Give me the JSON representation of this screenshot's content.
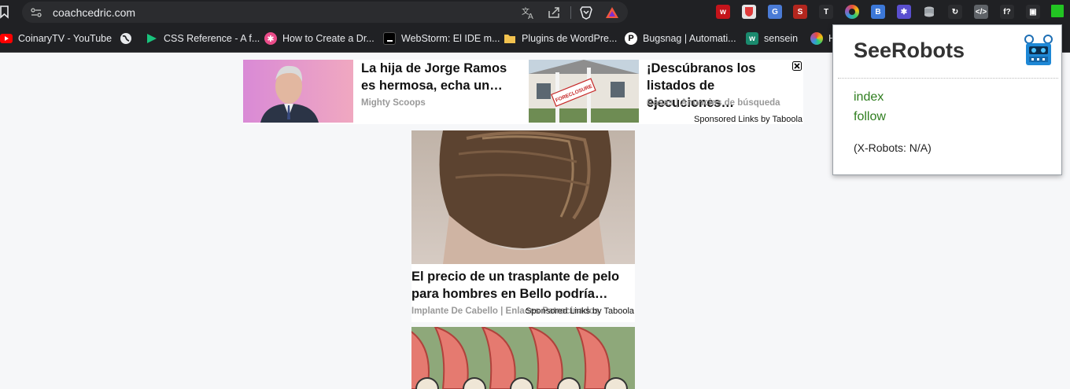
{
  "browser": {
    "url": "coachcedric.com",
    "extensions": [
      {
        "name": "wordpress-extension-icon",
        "color": "#c4141b",
        "glyph": "w"
      },
      {
        "name": "brave-shield-extension-icon",
        "color": "#e5e5e5",
        "glyph": ""
      },
      {
        "name": "translate-extension-icon",
        "color": "#4a7bd6",
        "glyph": "G"
      },
      {
        "name": "seo-extension-icon",
        "color": "#b3261e",
        "glyph": "S"
      },
      {
        "name": "typography-extension-icon",
        "color": "#2b2c2f",
        "glyph": "T"
      },
      {
        "name": "color-picker-extension-icon",
        "color": "#7b3fe4",
        "glyph": ""
      },
      {
        "name": "box-extension-icon",
        "color": "#3c78d8",
        "glyph": "B"
      },
      {
        "name": "gear-extension-icon",
        "color": "#5a4fcf",
        "glyph": "✱"
      },
      {
        "name": "database-extension-icon",
        "color": "#8a8d91",
        "glyph": ""
      },
      {
        "name": "refresh-extension-icon",
        "color": "#2b2c2f",
        "glyph": "↻"
      },
      {
        "name": "code-extension-icon",
        "color": "#5f6368",
        "glyph": "</>"
      },
      {
        "name": "font-extension-icon",
        "color": "#2b2c2f",
        "glyph": "f?"
      },
      {
        "name": "window-extension-icon",
        "color": "#2b2c2f",
        "glyph": "▣"
      },
      {
        "name": "seerobots-extension-icon",
        "color": "#22c422",
        "glyph": ""
      }
    ]
  },
  "bookmarks": [
    {
      "label": "CoinaryTV - YouTube",
      "icon": "youtube-icon",
      "color": "#ff0000"
    },
    {
      "label": "",
      "icon": "globe-icon",
      "color": "#e8eaed"
    },
    {
      "label": "CSS Reference - A f...",
      "icon": "css-reference-icon",
      "color": "#19c37d"
    },
    {
      "label": "How to Create a Dr...",
      "icon": "dribbble-icon",
      "color": "#ea4c89"
    },
    {
      "label": "WebStorm: El IDE m...",
      "icon": "webstorm-icon",
      "color": "#000000"
    },
    {
      "label": "Plugins de WordPre...",
      "icon": "folder-icon",
      "color": "#f2c24f"
    },
    {
      "label": "Bugsnag | Automati...",
      "icon": "bugsnag-icon",
      "color": "#ffffff"
    },
    {
      "label": "sensein",
      "icon": "sensein-icon",
      "color": "#1a8a6e"
    },
    {
      "label": "H",
      "icon": "colorful-circle-icon",
      "color": "#8a6de9"
    }
  ],
  "ads": {
    "row": [
      {
        "title": "La hija de Jorge Ramos es hermosa, echa un…",
        "source": "Mighty Scoops"
      },
      {
        "title": "¡Descúbranos los listados de ejecuciones…",
        "source": "Casas | Anuncios de búsqueda"
      }
    ],
    "sponsored_label": "Sponsored Links",
    "by_label": "by Taboola",
    "card": {
      "title": "El precio de un trasplante de pelo para hombres en Bello podría…",
      "source": "Implante De Cabello | Enlaces Patrocinados",
      "sponsored_label": "Sponsored Links",
      "by_label": "by Taboola"
    },
    "foreclosure_sign": "FORECLOSURE"
  },
  "popup": {
    "title": "SeeRobots",
    "links": [
      "index",
      "follow"
    ],
    "status": "(X-Robots: N/A)"
  }
}
